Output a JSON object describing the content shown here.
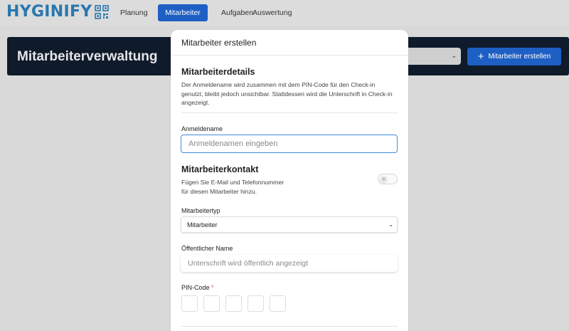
{
  "app": {
    "logo_text": "HYGINIFY"
  },
  "nav": [
    {
      "label": "Planung",
      "active": false
    },
    {
      "label": "Mitarbeiter",
      "active": true
    },
    {
      "label": "Aufgaben",
      "active": false
    },
    {
      "label": "Auswertung",
      "active": false
    }
  ],
  "page": {
    "title": "Mitarbeiterverwaltung"
  },
  "toolbar": {
    "create_label": "Mitarbeiter erstellen"
  },
  "modal": {
    "title": "Mitarbeiter erstellen",
    "details": {
      "heading": "Mitarbeiterdetails",
      "description": "Der Anmeldename wird zusammen mit dem PIN-Code für den Check-in genutzt, bleibt jedoch unsichtbar. Stattdessen wird die Unterschrift in Check-in angezeigt."
    },
    "login_name": {
      "label": "Anmeldename",
      "value": "",
      "placeholder": "Anmeldenamen eingeben"
    },
    "contact": {
      "heading": "Mitarbeiterkontakt",
      "description_line1": "Fügen Sie E-Mail und Telefonnummer",
      "description_line2": "für diesen Mitarbeiter hinzu.",
      "enabled": false
    },
    "employee_type": {
      "label": "Mitarbeitertyp",
      "selected": "Mitarbeiter"
    },
    "public_name": {
      "label": "Öffentlicher Name",
      "value": "",
      "placeholder": "Unterschrift wird öffentlich angezeigt"
    },
    "pin": {
      "label": "PIN-Code",
      "required_mark": "*"
    }
  },
  "colors": {
    "primary": "#1e5fc4",
    "logo": "#2a77ad",
    "header_dark": "#0f1a2b",
    "focus": "#3f8ce0"
  }
}
